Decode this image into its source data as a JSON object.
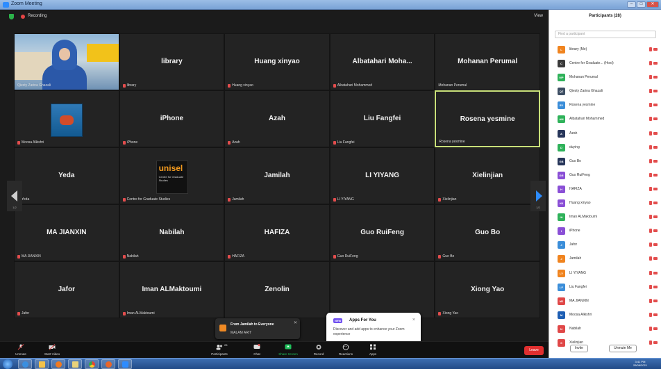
{
  "window": {
    "title": "Zoom Meeting"
  },
  "topbar": {
    "recording": "Recording",
    "view": "View"
  },
  "tiles": [
    {
      "big": "",
      "name": "Qiesty Zarina Ghazali",
      "muted": false,
      "type": "photo"
    },
    {
      "big": "library",
      "name": "library",
      "muted": true
    },
    {
      "big": "Huang xinyao",
      "name": "Huang xinyao",
      "muted": true
    },
    {
      "big": "Albatahari Moha...",
      "name": "Albatahari Mohammed",
      "muted": true
    },
    {
      "big": "Mohanan Perumal",
      "name": "Mohanan Perumal",
      "muted": false
    },
    {
      "big": "",
      "name": "Moosa Alkishri",
      "muted": true,
      "type": "scuba"
    },
    {
      "big": "iPhone",
      "name": "iPhone",
      "muted": true
    },
    {
      "big": "Azah",
      "name": "Azah",
      "muted": true
    },
    {
      "big": "Liu Fangfei",
      "name": "Liu Fangfei",
      "muted": true
    },
    {
      "big": "Rosena yesmine",
      "name": "Rosena yesmine",
      "muted": false,
      "active": true
    },
    {
      "big": "Yeda",
      "name": "Yeda",
      "muted": true
    },
    {
      "big": "",
      "name": "Centre for Graduate Studies",
      "muted": true,
      "type": "unisel"
    },
    {
      "big": "Jamilah",
      "name": "Jamilah",
      "muted": true
    },
    {
      "big": "LI YIYANG",
      "name": "LI YIYANG",
      "muted": true
    },
    {
      "big": "Xielinjian",
      "name": "Xielinjian",
      "muted": true
    },
    {
      "big": "MA JIANXIN",
      "name": "MA JIANXIN",
      "muted": true
    },
    {
      "big": "Nabilah",
      "name": "Nabilah",
      "muted": true
    },
    {
      "big": "HAFIZA",
      "name": "HAFIZA",
      "muted": true
    },
    {
      "big": "Guo RuiFeng",
      "name": "Guo RuiFeng",
      "muted": true
    },
    {
      "big": "Guo Bo",
      "name": "Guo Bo",
      "muted": true
    },
    {
      "big": "Jafor",
      "name": "Jafor",
      "muted": true
    },
    {
      "big": "Iman ALMaktoumi",
      "name": "Iman ALMaktoumi",
      "muted": true
    },
    {
      "big": "Zenolin",
      "name": "",
      "muted": false
    },
    {
      "big": "",
      "name": "",
      "muted": false
    },
    {
      "big": "Xiong Yao",
      "name": "Xiong Yao",
      "muted": true
    }
  ],
  "unisel": {
    "logo": "unisel",
    "sub": "Centre for Graduate Studies"
  },
  "pager": {
    "left": "1/2",
    "right": "1/2"
  },
  "chat_toast": {
    "from": "From Jamilah to Everyone",
    "message": "MALAM ARIT"
  },
  "apps_toast": {
    "badge": "NEW",
    "title": "Apps For You",
    "body": "Discover and add apps to enhance your Zoom experience",
    "close": "×"
  },
  "toolbar": {
    "unmute": "Unmute",
    "start_video": "Start Video",
    "participants": "Participants",
    "participants_count": "28",
    "chat": "Chat",
    "share_screen": "Share Screen",
    "record": "Record",
    "reactions": "Reactions",
    "apps": "Apps",
    "end": "Leave"
  },
  "panel": {
    "title": "Participants (28)",
    "search_placeholder": "Find a participant",
    "invite": "Invite",
    "unmute_all": "Unmute Me",
    "participants": [
      {
        "initials": "L",
        "name": "library (Me)",
        "color": "#f0841f"
      },
      {
        "initials": "C",
        "name": "Centre for Graduate... (Host)",
        "color": "#3a3a3a"
      },
      {
        "initials": "MP",
        "name": "Mohanan Perumal",
        "color": "#2fb25a"
      },
      {
        "initials": "QZ",
        "name": "Qiesty Zarina Ghazali",
        "color": "#3d4e63"
      },
      {
        "initials": "RY",
        "name": "Rosena yesmine",
        "color": "#3b8ed9"
      },
      {
        "initials": "AM",
        "name": "Albatahari Mohammed",
        "color": "#2fb25a"
      },
      {
        "initials": "A",
        "name": "Azah",
        "color": "#27365a"
      },
      {
        "initials": "D",
        "name": "duying",
        "color": "#2fb25a"
      },
      {
        "initials": "GB",
        "name": "Guo Bo",
        "color": "#27365a"
      },
      {
        "initials": "GR",
        "name": "Guo RuiFeng",
        "color": "#8a4fd6"
      },
      {
        "initials": "H",
        "name": "HAFIZA",
        "color": "#8a4fd6"
      },
      {
        "initials": "HX",
        "name": "Huang xinyao",
        "color": "#8a4fd6"
      },
      {
        "initials": "IA",
        "name": "Iman ALMaktoumi",
        "color": "#2fb25a"
      },
      {
        "initials": "I",
        "name": "iPhone",
        "color": "#8a4fd6"
      },
      {
        "initials": "J",
        "name": "Jafor",
        "color": "#3b8ed9"
      },
      {
        "initials": "J",
        "name": "Jamilah",
        "color": "#f0841f"
      },
      {
        "initials": "LY",
        "name": "LI YIYANG",
        "color": "#f0841f"
      },
      {
        "initials": "LF",
        "name": "Liu Fangfei",
        "color": "#3b8ed9"
      },
      {
        "initials": "MJ",
        "name": "MA JIANXIN",
        "color": "#e04848"
      },
      {
        "initials": "M",
        "name": "Moosa Alkishri",
        "color": "#1f5fb4"
      },
      {
        "initials": "N",
        "name": "Nabilah",
        "color": "#e04848"
      },
      {
        "initials": "X",
        "name": "Xielinjian",
        "color": "#e04848"
      }
    ]
  },
  "taskbar": {
    "time": "3:41 PM",
    "date": "26/06/2021"
  }
}
